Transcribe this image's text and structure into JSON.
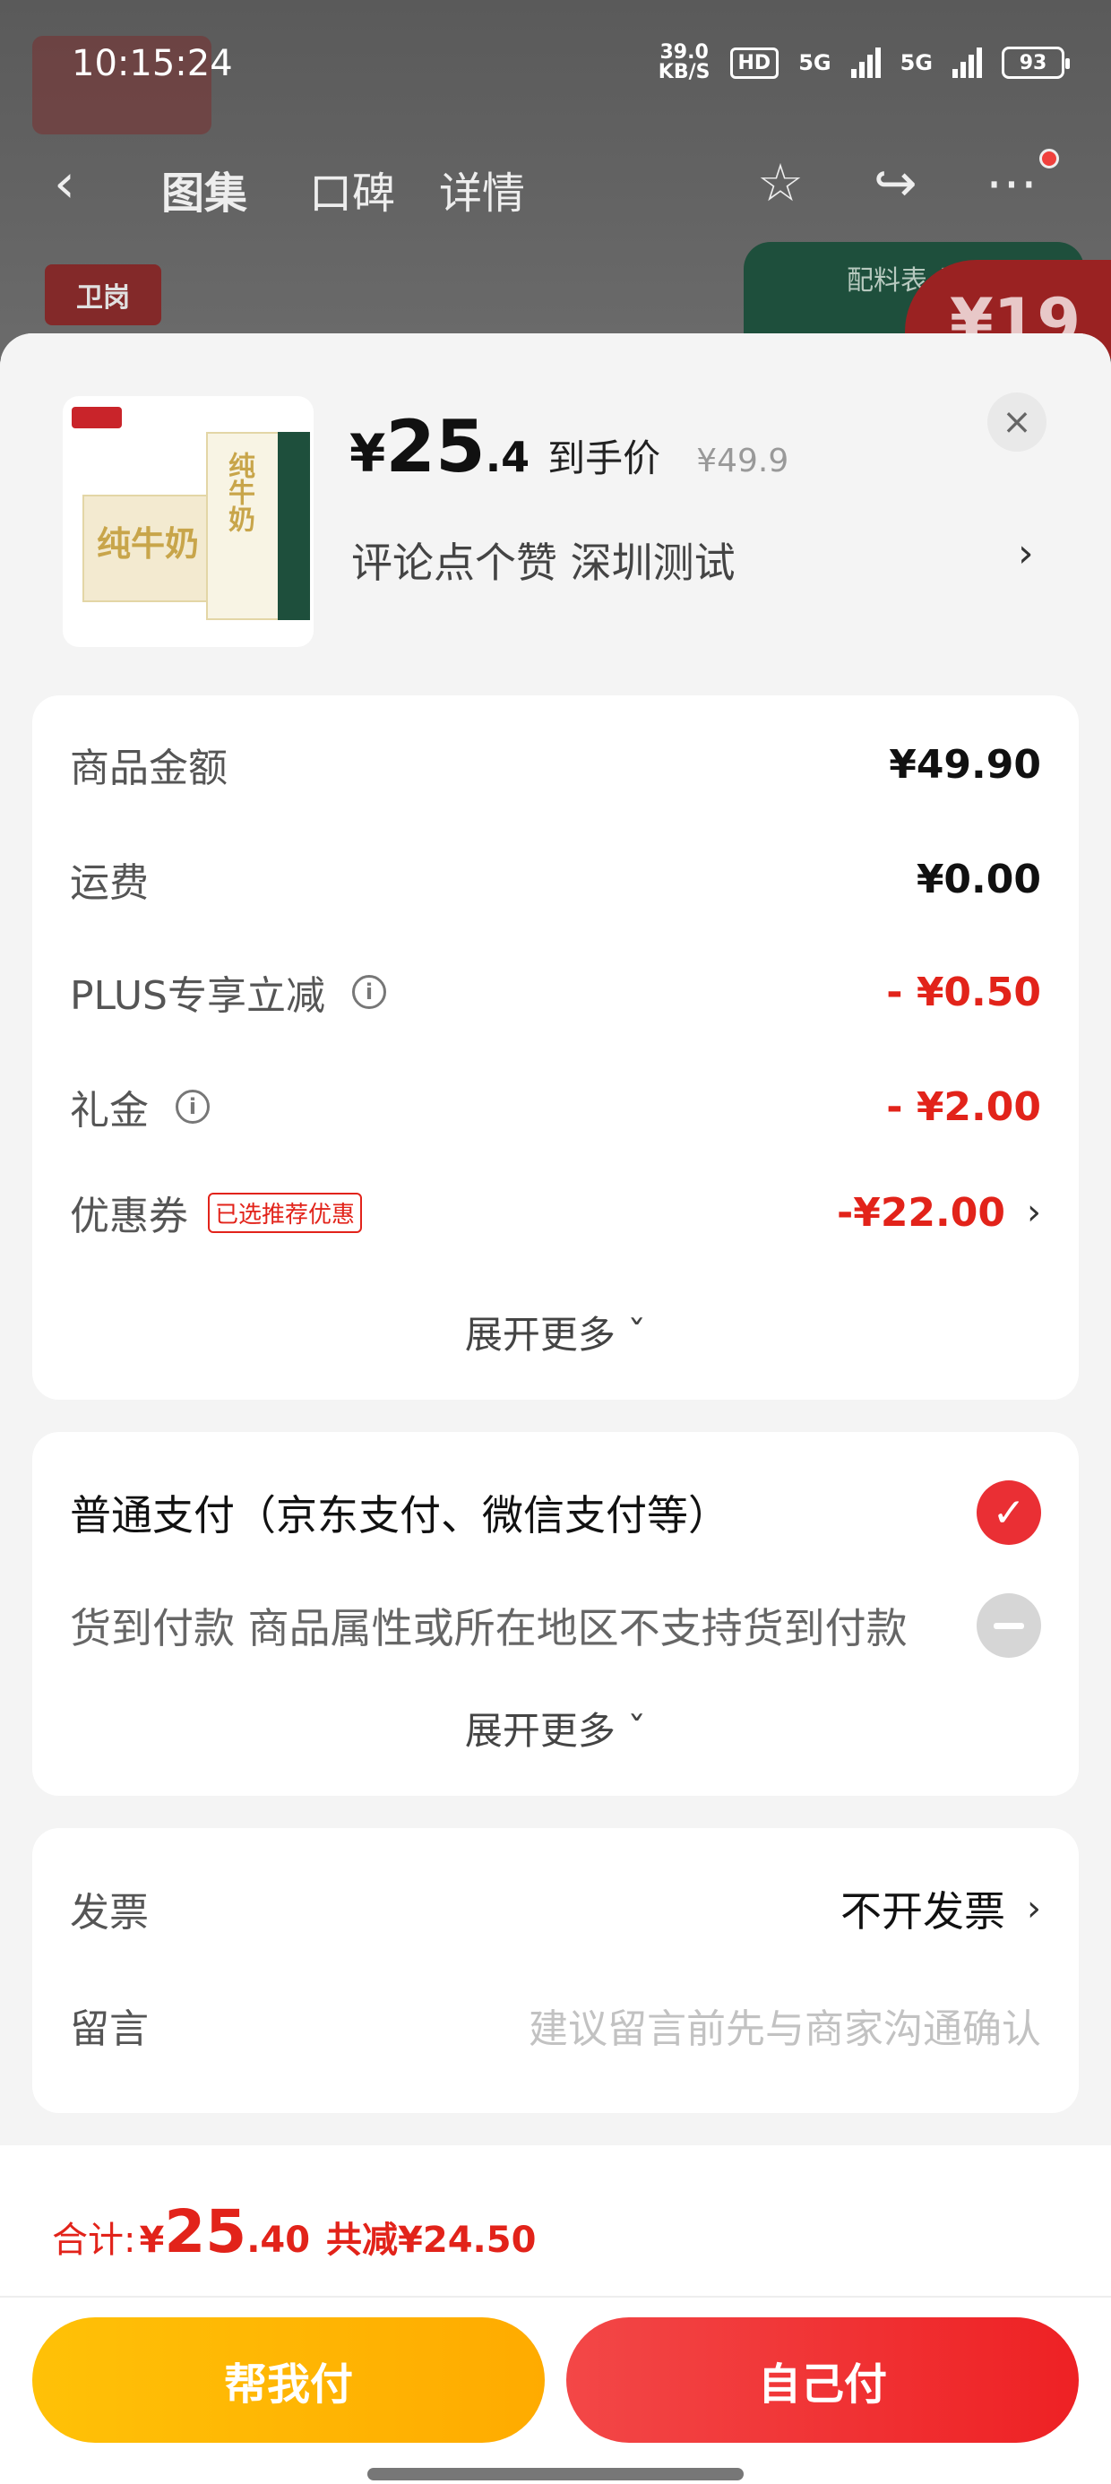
{
  "status_bar": {
    "time": "10:15:24",
    "net_speed_value": "39.0",
    "net_speed_unit": "KB/S",
    "hd": "HD",
    "sim1": "5G",
    "sim2": "5G",
    "battery": "93"
  },
  "nav": {
    "tabs": [
      "图集",
      "口碑",
      "详情"
    ],
    "back_icon": "chevron-left-icon",
    "icons": [
      "star-icon",
      "share-icon",
      "more-icon"
    ]
  },
  "background": {
    "brand_logo": "卫岗",
    "panel_text": "配料表 品质",
    "price_peek": "¥19"
  },
  "product": {
    "image_label": "纯牛奶",
    "price_yen": "¥",
    "price_int": "25",
    "price_dec": ".4",
    "price_label": "到手价",
    "original_price": "¥49.9",
    "desc": "评论点个赞  深圳测试",
    "desc_chevron": "›",
    "close_icon": "×"
  },
  "amounts": {
    "rows": [
      {
        "label": "商品金额",
        "value": "¥49.90"
      },
      {
        "label": "运费",
        "value": "¥0.00"
      },
      {
        "label": "PLUS专享立减",
        "value": "- ¥0.50"
      },
      {
        "label": "礼金",
        "value": "- ¥2.00"
      },
      {
        "label": "优惠券",
        "tag": "已选推荐优惠",
        "value": "-¥22.00"
      }
    ],
    "info_icon": "i",
    "expand": "展开更多 ˇ"
  },
  "payment": {
    "options": [
      {
        "label": "普通支付（京东支付、微信支付等）"
      },
      {
        "label": "货到付款 商品属性或所在地区不支持货到付款"
      }
    ],
    "check": "✓",
    "expand": "展开更多 ˇ"
  },
  "invoice": {
    "invoice_label": "发票",
    "invoice_value": "不开发票",
    "message_label": "留言",
    "message_placeholder": "建议留言前先与商家沟通确认"
  },
  "footer": {
    "total_label": "合计:",
    "total_yen": "¥",
    "total_int": "25",
    "total_dec": ".40",
    "savings": "共减¥24.50",
    "help_pay": "帮我付",
    "self_pay": "自己付"
  },
  "colors": {
    "accent_red": "#e2231a",
    "button_red": "#ee2124",
    "button_yellow": "#ffb300"
  }
}
